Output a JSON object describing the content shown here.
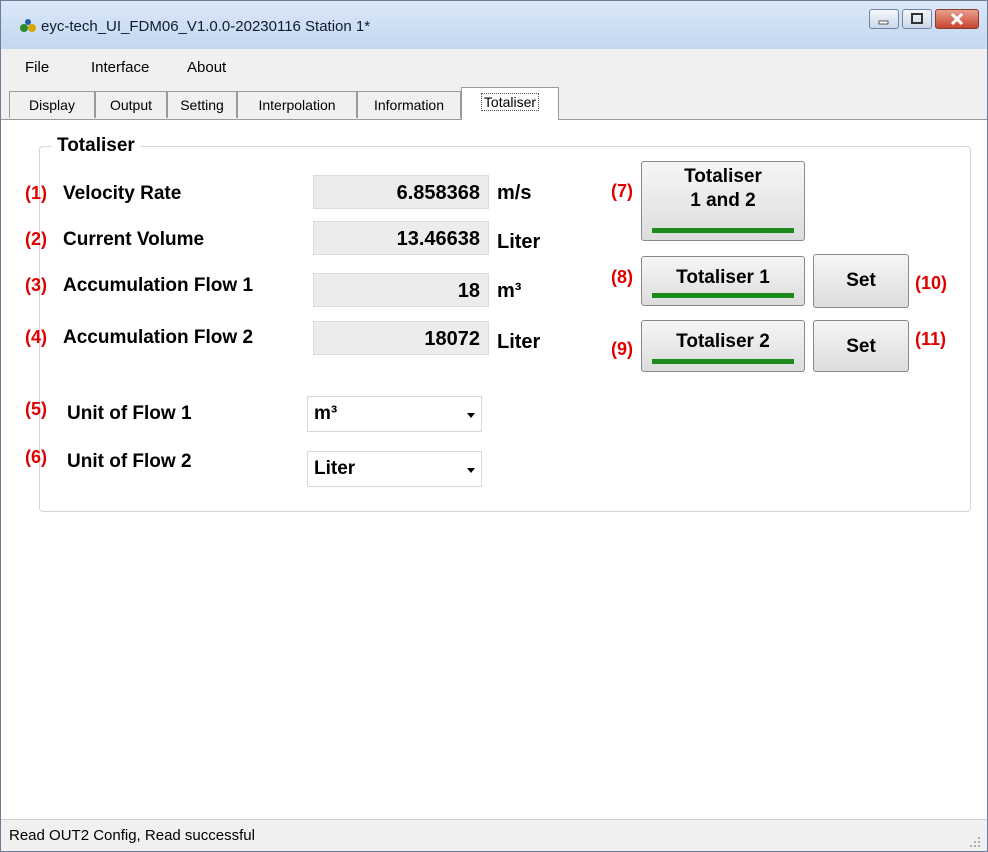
{
  "window": {
    "title": "eyc-tech_UI_FDM06_V1.0.0-20230116  Station 1*"
  },
  "menu": {
    "items": [
      "File",
      "Interface",
      "About"
    ]
  },
  "tabs": [
    "Display",
    "Output",
    "Setting",
    "Interpolation",
    "Information",
    "Totaliser"
  ],
  "active_tab": "Totaliser",
  "group": {
    "title": "Totaliser"
  },
  "rows": [
    {
      "num": "(1)",
      "label": "Velocity Rate",
      "value": "6.858368",
      "unit": "m/s"
    },
    {
      "num": "(2)",
      "label": "Current Volume",
      "value": "13.46638",
      "unit": "Liter"
    },
    {
      "num": "(3)",
      "label": "Accumulation Flow 1",
      "value": "18",
      "unit": "m³"
    },
    {
      "num": "(4)",
      "label": "Accumulation Flow 2",
      "value": "18072",
      "unit": "Liter"
    }
  ],
  "selects": [
    {
      "num": "(5)",
      "label": "Unit of Flow 1",
      "value": "m³"
    },
    {
      "num": "(6)",
      "label": "Unit of Flow 2",
      "value": "Liter"
    }
  ],
  "buttons": {
    "both": {
      "num": "(7)",
      "line1": "Totaliser",
      "line2": "1 and 2"
    },
    "t1": {
      "num": "(8)",
      "label": "Totaliser 1"
    },
    "t2": {
      "num": "(9)",
      "label": "Totaliser 2"
    },
    "set1": {
      "num": "(10)",
      "label": "Set"
    },
    "set2": {
      "num": "(11)",
      "label": "Set"
    }
  },
  "status": {
    "text": "Read OUT2 Config,   Read successful"
  },
  "colors": {
    "annotation": "#e00000",
    "indicator": "#1a8a1a"
  }
}
